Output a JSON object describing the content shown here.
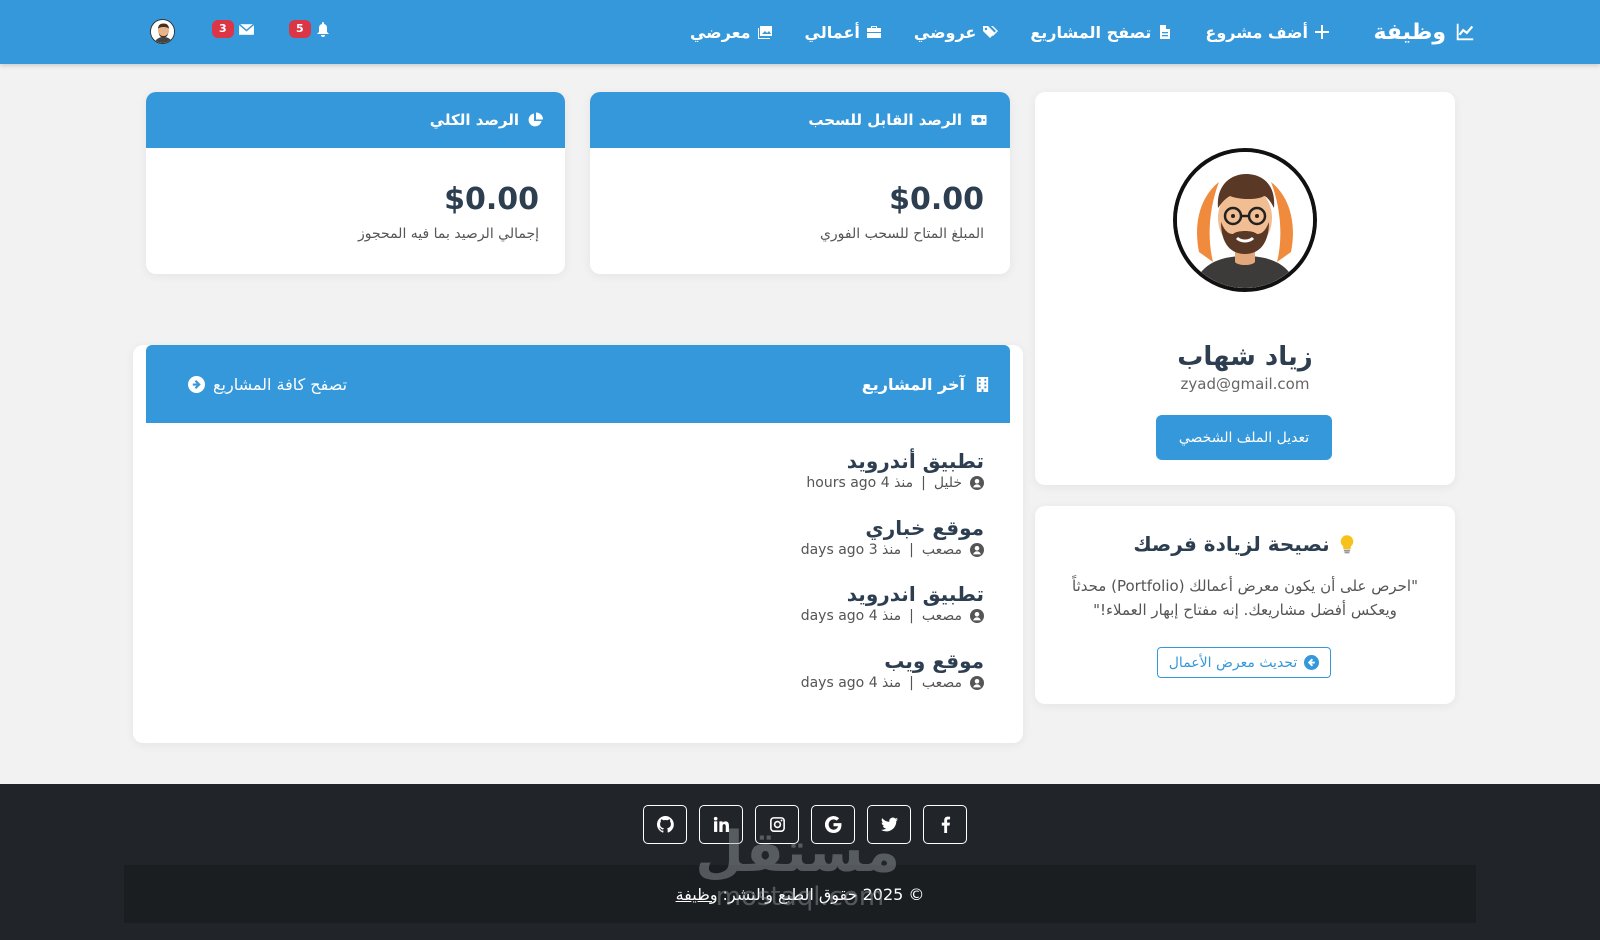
{
  "navbar": {
    "brand": "وظيفة",
    "links": [
      {
        "label": "أضف مشروع",
        "icon": "plus-icon"
      },
      {
        "label": "تصفح المشاريع",
        "icon": "file-icon"
      },
      {
        "label": "عروضي",
        "icon": "tags-icon"
      },
      {
        "label": "أعمالي",
        "icon": "briefcase-icon"
      },
      {
        "label": "معرضي",
        "icon": "images-icon"
      }
    ],
    "notifications_count": "5",
    "messages_count": "3"
  },
  "balances": {
    "withdrawable": {
      "title": "الرصد القابل للسحب",
      "amount": "$0.00",
      "note": "المبلغ المتاح للسحب الفوري"
    },
    "total": {
      "title": "الرصد الكلي",
      "amount": "$0.00",
      "note": "إجمالي الرصيد بما فيه المحجوز"
    }
  },
  "profile": {
    "name": "زياد شهاب",
    "email": "zyad@gmail.com",
    "edit_button": "تعديل الملف الشخصي"
  },
  "tip": {
    "title": "نصيحة لزيادة فرصك",
    "text": "\"احرص على أن يكون معرض أعمالك (Portfolio) محدثاً ويعكس أفضل مشاريعك. إنه مفتاح إبهار العملاء!\"",
    "button": "تحديث معرض الأعمال"
  },
  "projects": {
    "title": "آخر المشاريع",
    "browse_all": "تصفح كافة المشاريع",
    "items": [
      {
        "title": "تطبيق أندرويد",
        "owner": "خليل",
        "time": "منذ 4 hours ago"
      },
      {
        "title": "موقع خباري",
        "owner": "مصعب",
        "time": "منذ 3 days ago"
      },
      {
        "title": "تطبيق اندرويد",
        "owner": "مصعب",
        "time": "منذ 4 days ago"
      },
      {
        "title": "موقع ويب",
        "owner": "مصعب",
        "time": "منذ 4 days ago"
      }
    ]
  },
  "footer": {
    "socials": [
      "facebook-icon",
      "twitter-icon",
      "google-icon",
      "instagram-icon",
      "linkedin-icon",
      "github-icon"
    ],
    "copyright_prefix": "© 2025 حقوق الطبع والنشر:",
    "copyright_link": "وظيفة",
    "watermark_text": "مستقل",
    "watermark_domain": "mostaql.com"
  },
  "colors": {
    "primary": "#3498db",
    "danger": "#dc3545",
    "footer": "#212529"
  }
}
